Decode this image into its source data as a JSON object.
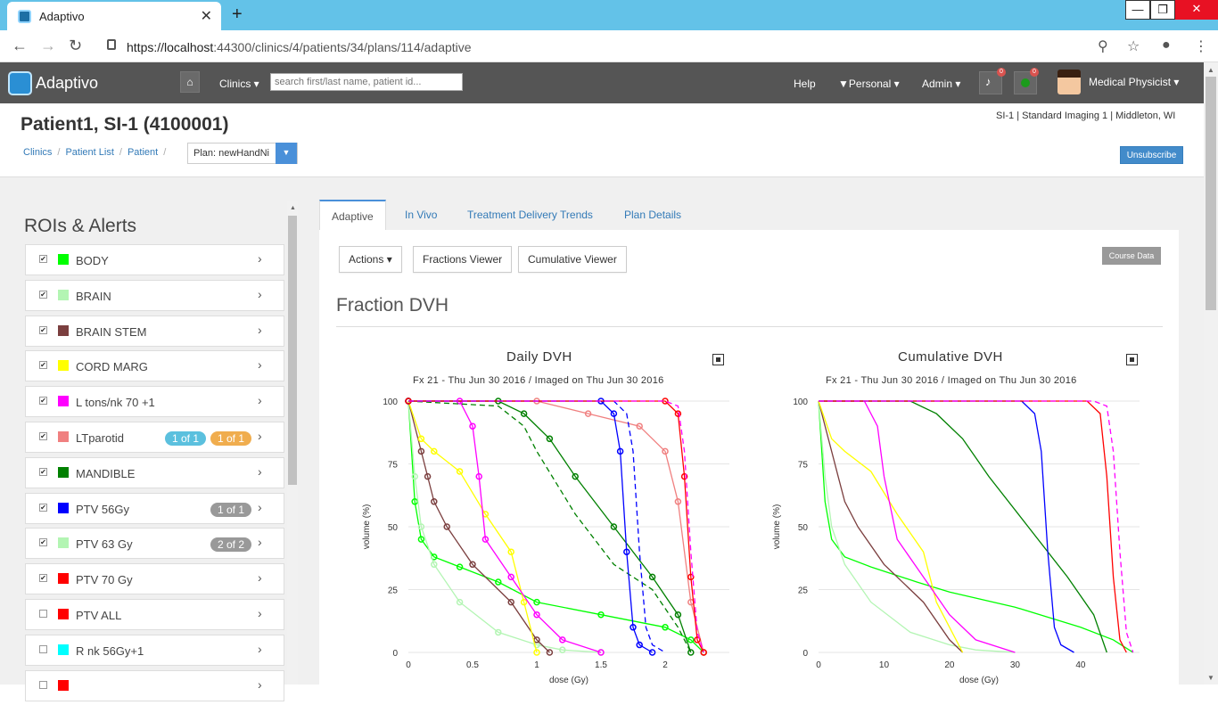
{
  "browser": {
    "tab_title": "Adaptivo",
    "url_host": "https://localhost",
    "url_rest": ":44300/clinics/4/patients/34/plans/114/adaptive"
  },
  "navbar": {
    "brand": "Adaptivo",
    "clinics": "Clinics",
    "search_placeholder": "search first/last name, patient id...",
    "help": "Help",
    "personal": "Personal",
    "admin": "Admin",
    "bell_count": "0",
    "status_count": "0",
    "user": "Medical Physicist"
  },
  "header": {
    "patient_title": "Patient1, SI-1 (4100001)",
    "site_info": "SI-1 | Standard Imaging 1 | Middleton, WI",
    "breadcrumb": [
      "Clinics",
      "Patient List",
      "Patient"
    ],
    "plan_select": "Plan: newHandNi",
    "unsubscribe": "Unsubscribe"
  },
  "roi_panel": {
    "title": "ROIs & Alerts",
    "items": [
      {
        "name": "BODY",
        "color": "#00ff00",
        "checked": true,
        "badges": []
      },
      {
        "name": "BRAIN",
        "color": "#b3f5b3",
        "checked": true,
        "badges": []
      },
      {
        "name": "BRAIN STEM",
        "color": "#7b3f3f",
        "checked": true,
        "badges": []
      },
      {
        "name": "CORD MARG",
        "color": "#ffff00",
        "checked": true,
        "badges": []
      },
      {
        "name": "L tons/nk 70 +1",
        "color": "#ff00ff",
        "checked": true,
        "badges": []
      },
      {
        "name": "LTparotid",
        "color": "#f08080",
        "checked": true,
        "badges": [
          {
            "text": "1 of 1",
            "color": "#5bc0de"
          },
          {
            "text": "1 of 1",
            "color": "#f0ad4e"
          }
        ]
      },
      {
        "name": "MANDIBLE",
        "color": "#008000",
        "checked": true,
        "badges": []
      },
      {
        "name": "PTV 56Gy",
        "color": "#0000ff",
        "checked": true,
        "badges": [
          {
            "text": "1 of 1",
            "color": "#999999"
          }
        ]
      },
      {
        "name": "PTV 63 Gy",
        "color": "#b3f5b3",
        "checked": true,
        "badges": [
          {
            "text": "2 of 2",
            "color": "#999999"
          }
        ]
      },
      {
        "name": "PTV 70 Gy",
        "color": "#ff0000",
        "checked": true,
        "badges": []
      },
      {
        "name": "PTV ALL",
        "color": "#ff0000",
        "checked": false,
        "badges": []
      },
      {
        "name": "R nk 56Gy+1",
        "color": "#00ffff",
        "checked": false,
        "badges": []
      },
      {
        "name": "",
        "color": "#ff0000",
        "checked": false,
        "badges": []
      }
    ]
  },
  "tabs": [
    "Adaptive",
    "In Vivo",
    "Treatment Delivery Trends",
    "Plan Details"
  ],
  "actions": {
    "actions": "Actions",
    "fractions_viewer": "Fractions Viewer",
    "cumulative_viewer": "Cumulative Viewer",
    "course_data": "Course Data"
  },
  "section_title": "Fraction DVH",
  "chart_data": [
    {
      "type": "line",
      "title": "Daily DVH",
      "subtitle": "Fx 21 - Thu Jun 30 2016 / Imaged on Thu Jun 30 2016",
      "xlabel": "dose (Gy)",
      "ylabel": "volume (%)",
      "xlim": [
        0,
        2.5
      ],
      "ylim": [
        0,
        100
      ],
      "xticks": [
        0,
        0.5,
        1,
        1.5,
        2
      ],
      "yticks": [
        0,
        25,
        50,
        75,
        100
      ],
      "series": [
        {
          "color": "#00ff00",
          "dash": false,
          "x": [
            0,
            0.05,
            0.1,
            0.2,
            0.4,
            0.7,
            1.0,
            1.5,
            2.0,
            2.2,
            2.3
          ],
          "y": [
            100,
            60,
            45,
            38,
            34,
            28,
            20,
            15,
            10,
            5,
            0
          ]
        },
        {
          "color": "#b3f5b3",
          "dash": false,
          "x": [
            0,
            0.05,
            0.1,
            0.2,
            0.4,
            0.7,
            1.0,
            1.2,
            1.5
          ],
          "y": [
            100,
            70,
            50,
            35,
            20,
            8,
            3,
            1,
            0
          ]
        },
        {
          "color": "#7b3f3f",
          "dash": false,
          "x": [
            0,
            0.1,
            0.15,
            0.2,
            0.3,
            0.5,
            0.8,
            1.0,
            1.1
          ],
          "y": [
            100,
            80,
            70,
            60,
            50,
            35,
            20,
            5,
            0
          ]
        },
        {
          "color": "#ffff00",
          "dash": false,
          "x": [
            0,
            0.1,
            0.2,
            0.4,
            0.6,
            0.8,
            0.9,
            1.0
          ],
          "y": [
            100,
            85,
            80,
            72,
            55,
            40,
            20,
            0
          ]
        },
        {
          "color": "#ff00ff",
          "dash": false,
          "x": [
            0,
            0.4,
            0.5,
            0.55,
            0.6,
            0.8,
            1.0,
            1.2,
            1.5
          ],
          "y": [
            100,
            100,
            90,
            70,
            45,
            30,
            15,
            5,
            0
          ]
        },
        {
          "color": "#f08080",
          "dash": false,
          "x": [
            0,
            1.0,
            1.4,
            1.8,
            2.0,
            2.1,
            2.2,
            2.3
          ],
          "y": [
            100,
            100,
            95,
            90,
            80,
            60,
            20,
            0
          ]
        },
        {
          "color": "#008000",
          "dash": false,
          "x": [
            0,
            0.7,
            0.9,
            1.1,
            1.3,
            1.6,
            1.9,
            2.1,
            2.2
          ],
          "y": [
            100,
            100,
            95,
            85,
            70,
            50,
            30,
            15,
            0
          ]
        },
        {
          "color": "#008000",
          "dash": true,
          "x": [
            0,
            0.7,
            0.9,
            1.0,
            1.3,
            1.6,
            1.9,
            2.1,
            2.2
          ],
          "y": [
            100,
            98,
            90,
            80,
            55,
            35,
            25,
            10,
            0
          ]
        },
        {
          "color": "#0000ff",
          "dash": false,
          "x": [
            0,
            1.5,
            1.6,
            1.65,
            1.7,
            1.75,
            1.8,
            1.9
          ],
          "y": [
            100,
            100,
            95,
            80,
            40,
            10,
            3,
            0
          ]
        },
        {
          "color": "#0000ff",
          "dash": true,
          "x": [
            0,
            1.6,
            1.7,
            1.75,
            1.8,
            1.85,
            1.9,
            2.0
          ],
          "y": [
            100,
            100,
            95,
            80,
            40,
            10,
            3,
            0
          ]
        },
        {
          "color": "#ff0000",
          "dash": false,
          "x": [
            0,
            2.0,
            2.1,
            2.15,
            2.2,
            2.25,
            2.3
          ],
          "y": [
            100,
            100,
            95,
            70,
            30,
            5,
            0
          ]
        },
        {
          "color": "#ff00ff",
          "dash": true,
          "x": [
            0,
            2.0,
            2.1,
            2.15,
            2.2,
            2.25,
            2.3
          ],
          "y": [
            100,
            100,
            98,
            80,
            40,
            8,
            0
          ]
        }
      ]
    },
    {
      "type": "line",
      "title": "Cumulative DVH",
      "subtitle": "Fx 21 - Thu Jun 30 2016 / Imaged on Thu Jun 30 2016",
      "xlabel": "dose (Gy)",
      "ylabel": "volume (%)",
      "xlim": [
        0,
        49
      ],
      "ylim": [
        0,
        100
      ],
      "xticks": [
        0,
        10,
        20,
        30,
        40
      ],
      "yticks": [
        0,
        25,
        50,
        75,
        100
      ],
      "series": [
        {
          "color": "#00ff00",
          "dash": false,
          "x": [
            0,
            1,
            2,
            4,
            8,
            15,
            20,
            30,
            40,
            45,
            48
          ],
          "y": [
            100,
            60,
            45,
            38,
            34,
            28,
            24,
            18,
            10,
            5,
            0
          ]
        },
        {
          "color": "#b3f5b3",
          "dash": false,
          "x": [
            0,
            1,
            2,
            4,
            8,
            14,
            20,
            24,
            30
          ],
          "y": [
            100,
            70,
            50,
            35,
            20,
            8,
            3,
            1,
            0
          ]
        },
        {
          "color": "#7b3f3f",
          "dash": false,
          "x": [
            0,
            2,
            3,
            4,
            6,
            10,
            16,
            20,
            22
          ],
          "y": [
            100,
            80,
            70,
            60,
            50,
            35,
            20,
            5,
            0
          ]
        },
        {
          "color": "#ffff00",
          "dash": false,
          "x": [
            0,
            2,
            4,
            8,
            12,
            16,
            18,
            22
          ],
          "y": [
            100,
            85,
            80,
            72,
            55,
            40,
            20,
            0
          ]
        },
        {
          "color": "#ff00ff",
          "dash": false,
          "x": [
            0,
            7,
            9,
            10,
            12,
            16,
            20,
            24,
            30
          ],
          "y": [
            100,
            100,
            90,
            70,
            45,
            30,
            15,
            5,
            0
          ]
        },
        {
          "color": "#008000",
          "dash": false,
          "x": [
            0,
            14,
            18,
            22,
            26,
            32,
            38,
            42,
            44
          ],
          "y": [
            100,
            100,
            95,
            85,
            70,
            50,
            30,
            15,
            0
          ]
        },
        {
          "color": "#0000ff",
          "dash": false,
          "x": [
            0,
            31,
            33,
            34,
            35,
            36,
            37,
            39
          ],
          "y": [
            100,
            100,
            95,
            80,
            40,
            10,
            3,
            0
          ]
        },
        {
          "color": "#ff0000",
          "dash": false,
          "x": [
            0,
            41,
            43,
            44,
            45,
            46,
            47
          ],
          "y": [
            100,
            100,
            95,
            70,
            30,
            5,
            0
          ]
        },
        {
          "color": "#ff00ff",
          "dash": true,
          "x": [
            0,
            42,
            44,
            45,
            46,
            47,
            48
          ],
          "y": [
            100,
            100,
            98,
            80,
            40,
            8,
            0
          ]
        }
      ]
    }
  ]
}
